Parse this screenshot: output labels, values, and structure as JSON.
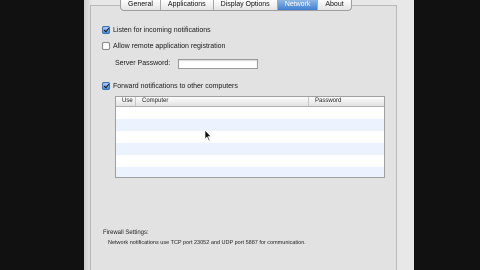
{
  "tabs": [
    {
      "label": "General",
      "active": false
    },
    {
      "label": "Applications",
      "active": false
    },
    {
      "label": "Display Options",
      "active": false
    },
    {
      "label": "Network",
      "active": true
    },
    {
      "label": "About",
      "active": false
    }
  ],
  "options": {
    "listen": {
      "label": "Listen for incoming notifications",
      "checked": true
    },
    "remote": {
      "label": "Allow remote application registration",
      "checked": false
    },
    "server_password_label": "Server Password:",
    "server_password_value": "",
    "forward": {
      "label": "Forward notifications to other computers",
      "checked": true
    }
  },
  "table": {
    "columns": [
      "Use",
      "Computer",
      "Password"
    ],
    "rows": []
  },
  "firewall": {
    "label": "Firewall Settings:",
    "text": "Network notifications use TCP port 23052 and UDP port 5887 for communication."
  },
  "colors": {
    "accent": "#3f7fd2",
    "row_stripe": "#edf3fe"
  }
}
